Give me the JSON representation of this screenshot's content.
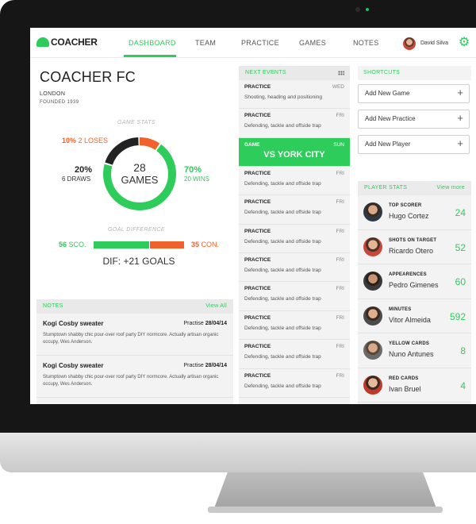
{
  "nav": {
    "logo": "COACHER",
    "tabs": [
      {
        "label": "DASHBOARD",
        "active": true
      },
      {
        "label": "TEAM",
        "active": false
      },
      {
        "label": "PRACTICE",
        "active": false
      },
      {
        "label": "GAMES",
        "active": false
      },
      {
        "label": "NOTES",
        "active": false
      }
    ],
    "user_name": "David Silva",
    "settings_icon": "gear-icon"
  },
  "team": {
    "name": "COACHER FC",
    "city": "LONDON",
    "founded": "FOUNDED 1939"
  },
  "game_stats": {
    "caption": "GAME STATS",
    "games_count": "28",
    "games_label": "GAMES",
    "loses_pct": "10%",
    "loses_label": "2 LOSES",
    "draws_pct": "20%",
    "draws_label": "6 DRAWS",
    "wins_pct": "70%",
    "wins_label": "20 WINS",
    "shares": {
      "wins": 0.7,
      "loses": 0.1,
      "draws": 0.2
    }
  },
  "goal_difference": {
    "caption": "GOAL DIFFERENCE",
    "scored_value": "56",
    "scored_label": "SCO.",
    "conceded_value": "35",
    "conceded_label": "CON.",
    "scored": 56,
    "conceded": 35,
    "summary": "DIF: +21 GOALS"
  },
  "notes": {
    "title": "NOTES",
    "view_all": "View All",
    "items": [
      {
        "title": "Kogi Cosby sweater",
        "tag": "Practise",
        "date": "28/04/14",
        "body": "Stumptown shabby chic pour-over roof party DIY normcore. Actually artisan organic occupy, Wes Anderson."
      },
      {
        "title": "Kogi Cosby sweater",
        "tag": "Practise",
        "date": "28/04/14",
        "body": "Stumptown shabby chic pour-over roof party DIY normcore. Actually artisan organic occupy, Wes Anderson."
      }
    ]
  },
  "events": {
    "title": "NEXT EVENTS",
    "items": [
      {
        "type": "PRACTICE",
        "day": "WED",
        "desc": "Shooting, heading and positioning",
        "highlight": false
      },
      {
        "type": "PRACTICE",
        "day": "FRI",
        "desc": "Defending, tackle and offside trap",
        "highlight": false
      },
      {
        "type": "GAME",
        "day": "SUN",
        "desc": "VS YORK CITY",
        "highlight": true
      },
      {
        "type": "PRACTICE",
        "day": "FRI",
        "desc": "Defending, tackle and offside trap",
        "highlight": false
      },
      {
        "type": "PRACTICE",
        "day": "FRI",
        "desc": "Defending, tackle and offside trap",
        "highlight": false
      },
      {
        "type": "PRACTICE",
        "day": "FRI",
        "desc": "Defending, tackle and offside trap",
        "highlight": false
      },
      {
        "type": "PRACTICE",
        "day": "FRI",
        "desc": "Defending, tackle and offside trap",
        "highlight": false
      },
      {
        "type": "PRACTICE",
        "day": "FRI",
        "desc": "Defending, tackle and offside trap",
        "highlight": false
      },
      {
        "type": "PRACTICE",
        "day": "FRI",
        "desc": "Defending, tackle and offside trap",
        "highlight": false
      },
      {
        "type": "PRACTICE",
        "day": "FRI",
        "desc": "Defending, tackle and offside trap",
        "highlight": false
      },
      {
        "type": "PRACTICE",
        "day": "FRI",
        "desc": "Defending, tackle and offside trap",
        "highlight": false
      }
    ]
  },
  "shortcuts": {
    "title": "SHORTCUTS",
    "items": [
      "Add New Game",
      "Add New Practice",
      "Add New Player"
    ]
  },
  "player_stats": {
    "title": "PLAYER STATS",
    "view_more": "View more",
    "items": [
      {
        "caption": "TOP SCORER",
        "name": "Hugo Cortez",
        "value": "24"
      },
      {
        "caption": "SHOTS ON TARGET",
        "name": "Ricardo Otero",
        "value": "52"
      },
      {
        "caption": "APPEARENCES",
        "name": "Pedro Gimenes",
        "value": "60"
      },
      {
        "caption": "MINUTES",
        "name": "Vitor Almeida",
        "value": "592"
      },
      {
        "caption": "YELLOW CARDS",
        "name": "Nuno Antunes",
        "value": "8"
      },
      {
        "caption": "RED CARDS",
        "name": "Ivan Bruel",
        "value": "4"
      }
    ]
  },
  "colors": {
    "accent": "#2ecc5a",
    "warning": "#f0612b",
    "dark": "#222222"
  }
}
